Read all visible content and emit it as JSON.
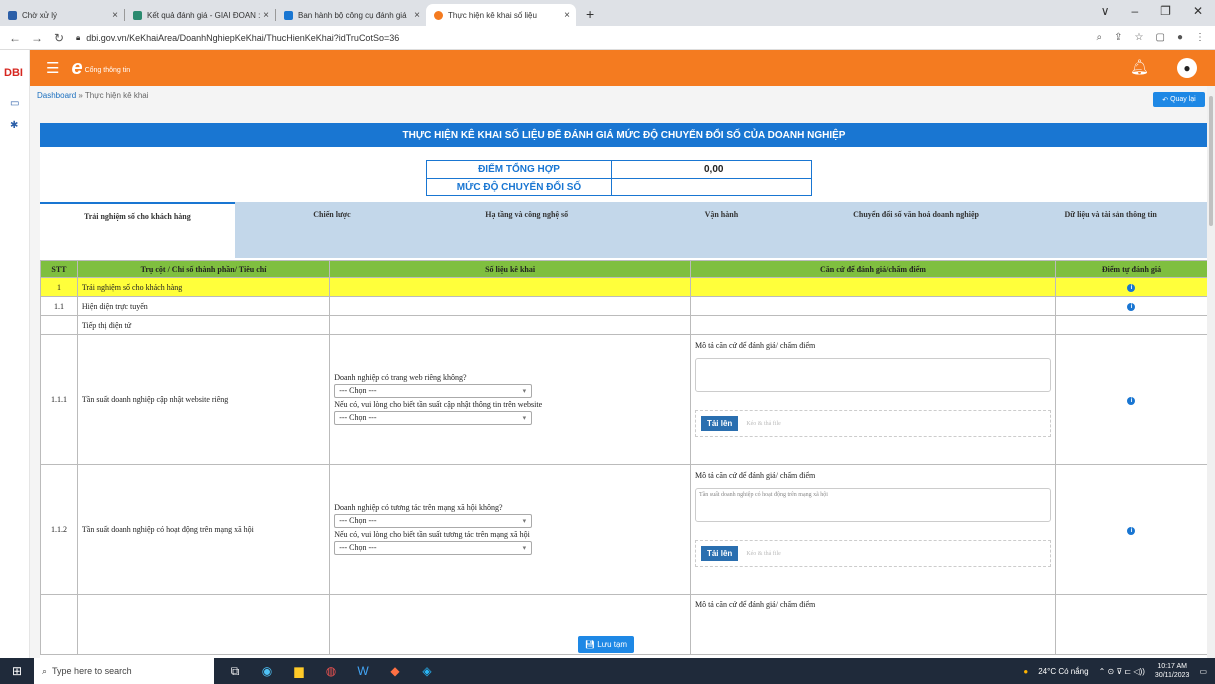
{
  "browser": {
    "tabs": [
      {
        "title": "Chờ xử lý",
        "color": "#2c5fa8"
      },
      {
        "title": "Kết quả đánh giá - GIAI ĐOAN :",
        "color": "#2a8a6f"
      },
      {
        "title": "Ban hành bộ công cụ đánh giá",
        "color": "#1976d2"
      },
      {
        "title": "Thực hiện kê khai số liệu",
        "color": "#f47b20"
      }
    ],
    "new_tab": "+",
    "url": "dbi.gov.vn/KeKhaiArea/DoanhNghiepKeKhai/ThucHienKeKhai?idTruCotSo=36",
    "window_controls": [
      "∨",
      "–",
      "❐",
      "✕"
    ]
  },
  "app": {
    "brand": "DBI",
    "portal": "Cổng thông tin",
    "breadcrumb": {
      "home": "Dashboard",
      "sep": " » ",
      "current": "Thực hiện kê khai"
    },
    "back": "Quay lại",
    "title": "THỰC HIỆN KÊ KHAI SỐ LIỆU ĐỂ ĐÁNH GIÁ MỨC ĐỘ CHUYỂN ĐỔI SỐ CỦA DOANH NGHIỆP",
    "score_label": "ĐIỂM TỔNG HỢP",
    "score_value": "0,00",
    "level_label": "MỨC ĐỘ CHUYỂN ĐỔI SỐ",
    "tabs": [
      "Trải nghiệm số cho khách hàng",
      "Chiến lược",
      "Hạ tầng và công nghệ số",
      "Vận hành",
      "Chuyển đổi số văn hoá doanh nghiệp",
      "Dữ liệu và tài sản thông tin"
    ],
    "headers": [
      "STT",
      "Trụ cột / Chỉ số thành phần/ Tiêu chí",
      "Số liệu kê khai",
      "Căn cứ để đánh giá/chấm điểm",
      "Điểm tự đánh giá"
    ],
    "rows": {
      "r1": {
        "stt": "1",
        "name": "Trải nghiệm số cho khách hàng"
      },
      "r2": {
        "stt": "1.1",
        "name": "Hiện diện trực tuyến"
      },
      "r3": {
        "name": "Tiếp thị điện tử"
      },
      "r4": {
        "stt": "1.1.1",
        "name": "Tần suất doanh nghiệp cập nhật website riêng",
        "q1": "Doanh nghiệp có trang web riêng không?",
        "q2": "Nếu có, vui lòng cho biết tần suất cập nhật thông tin trên website",
        "sel1": "--- Chọn ---",
        "sel2": "--- Chọn ---",
        "mo": "Mô tả căn cứ để đánh giá/ chấm điểm",
        "ta": "",
        "upload": "Tải lên",
        "drop": "Kéo & thả file"
      },
      "r5": {
        "stt": "1.1.2",
        "name": "Tần suất doanh nghiệp có hoạt động trên mạng xã hội",
        "q1": "Doanh nghiệp có tương tác trên mạng xã hội không?",
        "q2": "Nếu có, vui lòng cho biết tần suất tương tác trên mạng xã hội",
        "sel1": "--- Chọn ---",
        "sel2": "--- Chọn ---",
        "mo": "Mô tả căn cứ để đánh giá/ chấm điểm",
        "ta": "Tần suất doanh nghiệp có hoạt động trên mạng xã hội",
        "upload": "Tải lên",
        "drop": "Kéo & thả file"
      },
      "r6": {
        "mo": "Mô tả căn cứ để đánh giá/ chấm điểm"
      }
    },
    "save": "Lưu tạm"
  },
  "taskbar": {
    "search": "Type here to search",
    "weather": "24°C Có nắng",
    "time": "10:17 AM",
    "date": "30/11/2023"
  }
}
